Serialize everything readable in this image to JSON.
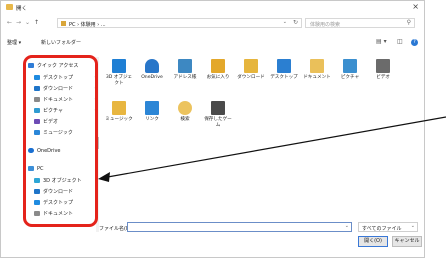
{
  "window": {
    "title": "開く",
    "close_glyph": "×"
  },
  "address": {
    "back_glyph": "←",
    "forward_glyph": "→",
    "recent_glyph": "⌄",
    "up_glyph": "↑",
    "path": "PC › 体験用 › ...",
    "path_dropdown_glyph": "⌄",
    "refresh_glyph": "↻",
    "search_placeholder": "体験用の検索",
    "search_glyph": "⚲"
  },
  "toolbar": {
    "organize_label": "整理 ▾",
    "new_folder_label": "新しいフォルダー",
    "view_glyph": "▤ ▾",
    "pane_glyph": "◫",
    "help_glyph": "?"
  },
  "sidebar": {
    "items": [
      {
        "label": "クイック アクセス",
        "icon": "star-icon",
        "color": "#2f7cd6"
      },
      {
        "label": "デスクトップ",
        "icon": "desktop-icon",
        "color": "#1f8be0",
        "pin": "✓"
      },
      {
        "label": "ダウンロード",
        "icon": "download-icon",
        "color": "#1e74c8",
        "pin": "✓"
      },
      {
        "label": "ドキュメント",
        "icon": "document-icon",
        "color": "#8a8a8a",
        "pin": "✓"
      },
      {
        "label": "ピクチャ",
        "icon": "picture-icon",
        "color": "#2f9bd1",
        "pin": "✓"
      },
      {
        "label": "ビデオ",
        "icon": "video-icon",
        "color": "#6d4bb5"
      },
      {
        "label": "ミュージック",
        "icon": "music-icon",
        "color": "#2a86d8"
      },
      {
        "label": "OneDrive",
        "icon": "cloud-icon",
        "color": "#1a6fd1"
      },
      {
        "label": "PC",
        "icon": "pc-icon",
        "color": "#3c8fd8"
      },
      {
        "label": "3D オブジェクト",
        "icon": "cube-icon",
        "color": "#2da6d6"
      },
      {
        "label": "ダウンロード",
        "icon": "download-icon",
        "color": "#1e74c8"
      },
      {
        "label": "デスクトップ",
        "icon": "desktop-icon",
        "color": "#1f8be0"
      },
      {
        "label": "ドキュメント",
        "icon": "document-icon",
        "color": "#8a8a8a"
      }
    ]
  },
  "files": [
    {
      "label": "3D オブジェクト",
      "icon": "cube-folder-icon",
      "color": "#1f7fd4"
    },
    {
      "label": "OneDrive",
      "icon": "cloud-folder-icon",
      "color": "#2876c9"
    },
    {
      "label": "アドレス帳",
      "icon": "contacts-folder-icon",
      "color": "#3d88c2"
    },
    {
      "label": "お気に入り",
      "icon": "star-folder-icon",
      "color": "#e3a82b"
    },
    {
      "label": "ダウンロード",
      "icon": "download-folder-icon",
      "color": "#e6b53d"
    },
    {
      "label": "デスクトップ",
      "icon": "desktop-folder-icon",
      "color": "#2b7fd1"
    },
    {
      "label": "ドキュメント",
      "icon": "document-folder-icon",
      "color": "#eac05a"
    },
    {
      "label": "ピクチャ",
      "icon": "picture-folder-icon",
      "color": "#3b8fcf"
    },
    {
      "label": "ビデオ",
      "icon": "video-folder-icon",
      "color": "#6b6b6b"
    },
    {
      "label": "ミュージック",
      "icon": "music-folder-icon",
      "color": "#e8b640"
    },
    {
      "label": "リンク",
      "icon": "link-folder-icon",
      "color": "#2c86d6"
    },
    {
      "label": "検索",
      "icon": "search-folder-icon",
      "color": "#ecc35e"
    },
    {
      "label": "保存したゲーム",
      "icon": "game-folder-icon",
      "color": "#4a4a4a"
    }
  ],
  "bottom": {
    "filename_label": "ファイル名(N):",
    "filename_value": "",
    "filename_dropdown_glyph": "⌄",
    "filter_value": "すべてのファイル",
    "filter_dropdown_glyph": "⌄",
    "open_label": "開く(O)",
    "cancel_label": "キャンセル"
  },
  "colors": {
    "highlight": "#e4231b",
    "accent": "#3a78d6"
  }
}
